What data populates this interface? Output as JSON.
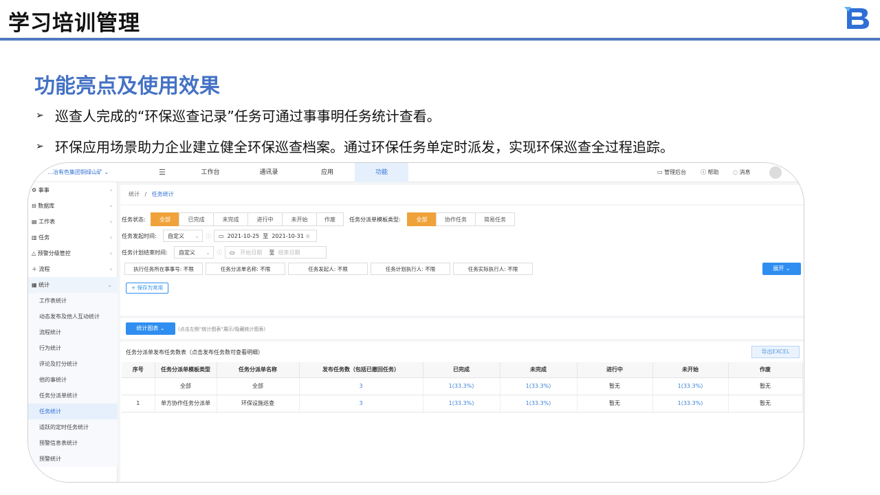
{
  "slide": {
    "title": "学习培训管理",
    "section_title": "功能亮点及使用效果",
    "bullets": [
      "巡查人完成的“环保巡查记录”任务可通过事事明任务统计查看。",
      "环保应用场景助力企业建立健全环保巡查档案。通过环保任务单定时派发，实现环保巡查全过程追踪。"
    ],
    "accent_color": "#4472c4",
    "rule_color": "#4f79c3"
  },
  "app": {
    "org_name": "…冶有色集团铜绿山矿",
    "nav": [
      "工作台",
      "通讯录",
      "应用",
      "功能"
    ],
    "nav_active": "功能",
    "top_right": {
      "admin": "管理后台",
      "help": "帮助",
      "messages": "消息"
    },
    "sidebar": {
      "items": [
        "事事",
        "数据库",
        "工作表",
        "任务",
        "预警分级管控",
        "流程",
        "统计"
      ],
      "sub_items": [
        "工作表统计",
        "动态发布及他人互动统计",
        "流程统计",
        "行为统计",
        "评论及打分统计",
        "他的事统计",
        "任务分派单统计",
        "任务统计",
        "适跃的定时任务统计",
        "预警信息表统计",
        "预警统计"
      ],
      "active_sub": "任务统计"
    },
    "breadcrumb": {
      "root": "统计",
      "sep": "/",
      "current": "任务统计"
    },
    "filters": {
      "status_label": "任务状态:",
      "status_options": [
        "全部",
        "已完成",
        "未完成",
        "进行中",
        "未开始",
        "作废"
      ],
      "template_label": "任务分派单模板类型:",
      "template_options": [
        "全部",
        "协作任务",
        "简易任务"
      ],
      "start_label": "任务发起时间:",
      "start_mode": "自定义",
      "start_from": "2021-10-25",
      "range_sep": "至",
      "start_to": "2021-10-31",
      "end_label": "任务计划结束时间:",
      "end_mode": "自定义",
      "end_from_placeholder": "开始日期",
      "end_to_placeholder": "结束日期",
      "chips": [
        "执行任务所在事事号: 不限",
        "任务分派单名称: 不限",
        "任务发起人: 不限",
        "任务计划执行人: 不限",
        "任务实际执行人: 不限"
      ],
      "expand_label": "展开",
      "save_label": "+ 保存为常用"
    },
    "chart": {
      "button_label": "统计图表",
      "hint": "(点击左侧“统计图表”展示/隐藏统计图表)"
    },
    "table": {
      "title": "任务分派单发布任务数表（点击发布任务数可查看明细）",
      "export_label": "导出EXCEL",
      "headers": [
        "序号",
        "任务分派单模板类型",
        "任务分派单名称",
        "发布任务数（包括已撤回任务）",
        "已完成",
        "未完成",
        "进行中",
        "未开始",
        "作废"
      ],
      "rows": [
        [
          "",
          "全部",
          "全部",
          "3",
          "1(33.3%)",
          "1(33.3%)",
          "暂无",
          "1(33.3%)",
          "暂无"
        ],
        [
          "1",
          "单方协作任务分派单",
          "环保设施巡查",
          "3",
          "1(33.3%)",
          "1(33.3%)",
          "暂无",
          "1(33.3%)",
          "暂无"
        ]
      ]
    }
  }
}
